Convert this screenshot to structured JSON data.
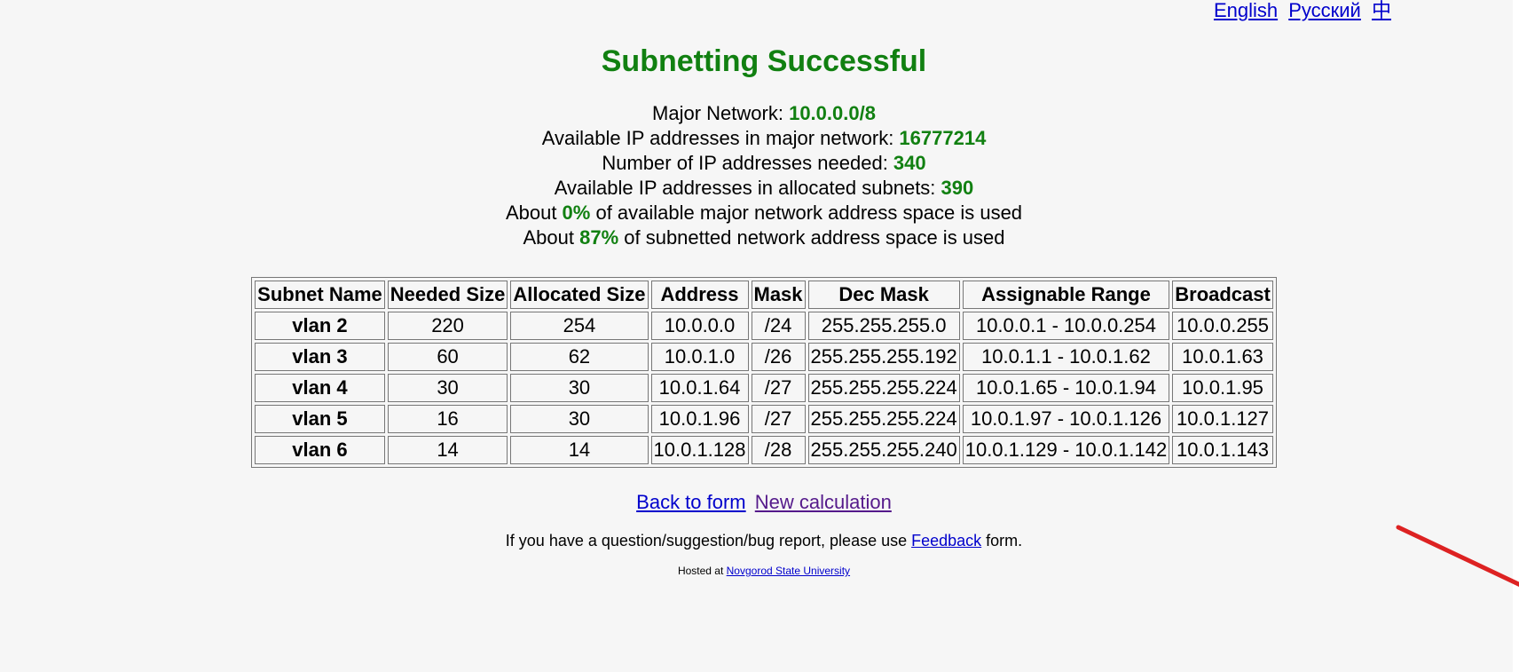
{
  "lang_links": [
    "English",
    "Русский",
    "中"
  ],
  "title": "Subnetting Successful",
  "stats": {
    "major_network_label": "Major Network: ",
    "major_network_value": "10.0.0.0/8",
    "available_major_label": "Available IP addresses in major network: ",
    "available_major_value": "16777214",
    "needed_label": "Number of IP addresses needed: ",
    "needed_value": "340",
    "available_allocated_label": "Available IP addresses in allocated subnets: ",
    "available_allocated_value": "390",
    "major_used_prefix": "About ",
    "major_used_value": "0%",
    "major_used_suffix": " of available major network address space is used",
    "subnetted_used_prefix": "About ",
    "subnetted_used_value": "87%",
    "subnetted_used_suffix": " of subnetted network address space is used"
  },
  "table": {
    "headers": [
      "Subnet Name",
      "Needed Size",
      "Allocated Size",
      "Address",
      "Mask",
      "Dec Mask",
      "Assignable Range",
      "Broadcast"
    ],
    "rows": [
      [
        "vlan 2",
        "220",
        "254",
        "10.0.0.0",
        "/24",
        "255.255.255.0",
        "10.0.0.1 - 10.0.0.254",
        "10.0.0.255"
      ],
      [
        "vlan 3",
        "60",
        "62",
        "10.0.1.0",
        "/26",
        "255.255.255.192",
        "10.0.1.1 - 10.0.1.62",
        "10.0.1.63"
      ],
      [
        "vlan 4",
        "30",
        "30",
        "10.0.1.64",
        "/27",
        "255.255.255.224",
        "10.0.1.65 - 10.0.1.94",
        "10.0.1.95"
      ],
      [
        "vlan 5",
        "16",
        "30",
        "10.0.1.96",
        "/27",
        "255.255.255.224",
        "10.0.1.97 - 10.0.1.126",
        "10.0.1.127"
      ],
      [
        "vlan 6",
        "14",
        "14",
        "10.0.1.128",
        "/28",
        "255.255.255.240",
        "10.0.1.129 - 10.0.1.142",
        "10.0.1.143"
      ]
    ]
  },
  "links": {
    "back": "Back to form",
    "new": "New calculation"
  },
  "feedback": {
    "prefix": "If you have a question/suggestion/bug report, please use ",
    "link": "Feedback",
    "suffix": " form."
  },
  "hosted": {
    "prefix": "Hosted at ",
    "link": "Novgorod State University"
  },
  "colors": {
    "accent_green": "#118011",
    "link_blue": "#0000cc",
    "visited_purple": "#551a8b",
    "annotation_red": "#dd2222"
  }
}
